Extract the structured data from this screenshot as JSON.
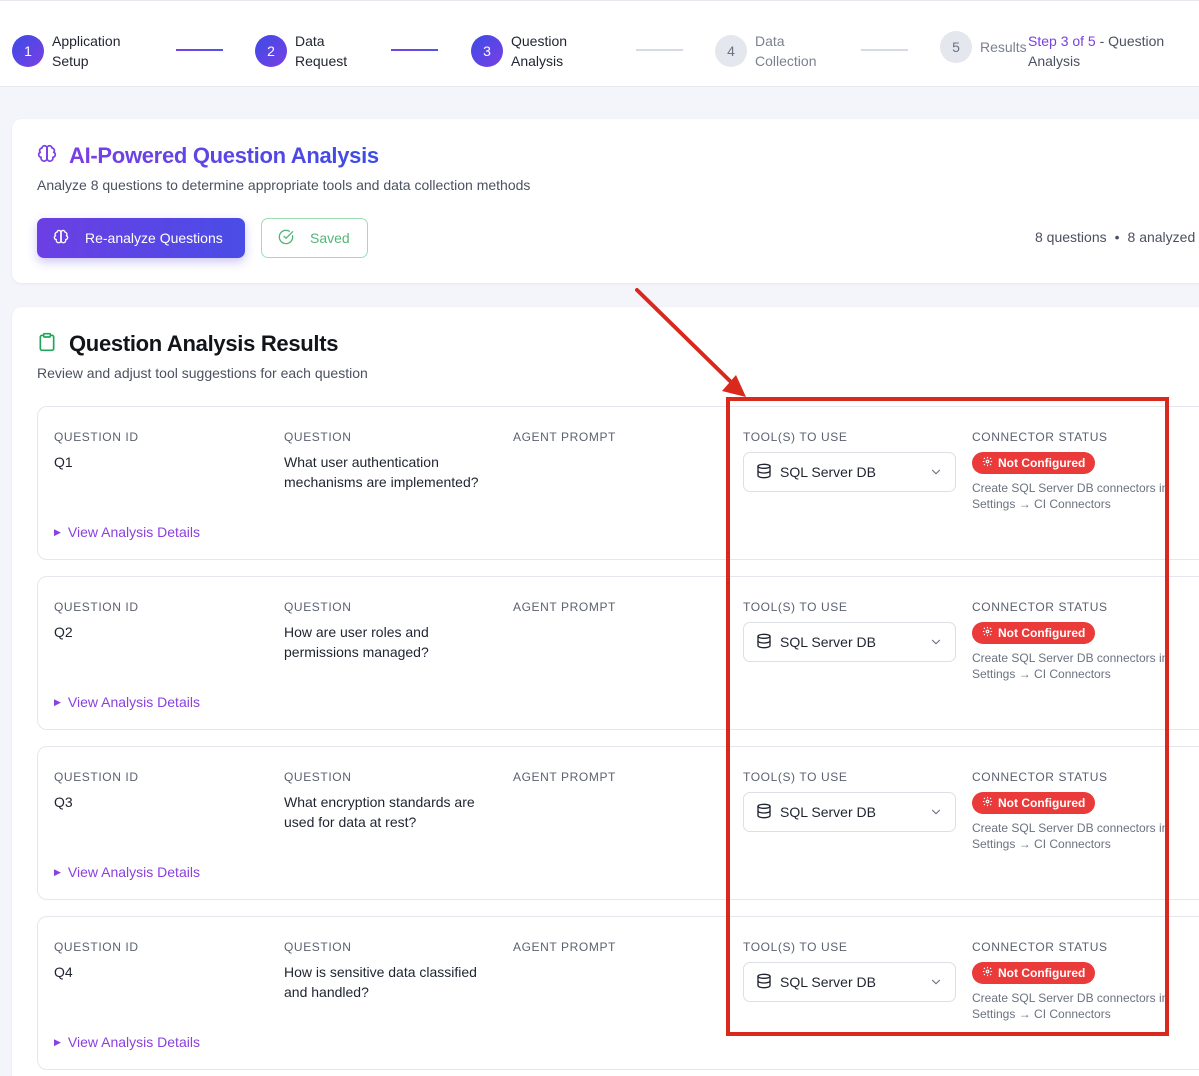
{
  "stepper": {
    "steps": [
      {
        "num": "1",
        "label_line1": "Application",
        "label_line2": "Setup",
        "state": "done"
      },
      {
        "num": "2",
        "label_line1": "Data",
        "label_line2": "Request",
        "state": "done"
      },
      {
        "num": "3",
        "label_line1": "Question",
        "label_line2": "Analysis",
        "state": "current"
      },
      {
        "num": "4",
        "label_line1": "Data",
        "label_line2": "Collection",
        "state": "todo"
      },
      {
        "num": "5",
        "label_line1": "Results",
        "label_line2": "",
        "state": "todo"
      }
    ],
    "info_highlight": "Step 3 of 5",
    "info_rest": " - Question Analysis"
  },
  "analysis": {
    "title": "AI-Powered Question Analysis",
    "subtitle": "Analyze 8 questions to determine appropriate tools and data collection methods",
    "reanalyze_label": "Re-analyze Questions",
    "saved_label": "Saved",
    "stats_questions": "8 questions",
    "stats_dot": "•",
    "stats_analyzed": "8 analyzed"
  },
  "results": {
    "title": "Question Analysis Results",
    "subtitle": "Review and adjust tool suggestions for each question",
    "headers": {
      "question_id": "QUESTION ID",
      "question": "QUESTION",
      "agent_prompt": "AGENT PROMPT",
      "tools": "TOOL(S) TO USE",
      "connector_status": "CONNECTOR STATUS"
    },
    "view_details_label": "View Analysis Details",
    "rows": [
      {
        "id": "Q1",
        "question": "What user authentication mechanisms are implemented?",
        "agent_prompt": "",
        "tool": "SQL Server DB",
        "status": "Not Configured",
        "note": "Create SQL Server DB connectors in Settings → CI Connectors"
      },
      {
        "id": "Q2",
        "question": "How are user roles and permissions managed?",
        "agent_prompt": "",
        "tool": "SQL Server DB",
        "status": "Not Configured",
        "note": "Create SQL Server DB connectors in Settings → CI Connectors"
      },
      {
        "id": "Q3",
        "question": "What encryption standards are used for data at rest?",
        "agent_prompt": "",
        "tool": "SQL Server DB",
        "status": "Not Configured",
        "note": "Create SQL Server DB connectors in Settings → CI Connectors"
      },
      {
        "id": "Q4",
        "question": "How is sensitive data classified and handled?",
        "agent_prompt": "",
        "tool": "SQL Server DB",
        "status": "Not Configured",
        "note": "Create SQL Server DB connectors in Settings → CI Connectors"
      }
    ]
  },
  "colors": {
    "accent_purple": "#7b3fe4",
    "accent_blue": "#3b4ce6",
    "status_red": "#ea3a3a",
    "saved_green": "#54b57a",
    "annotation_red": "#d9281c"
  },
  "icons": {
    "brain": "brain-icon",
    "clipboard": "clipboard-icon",
    "check_circle": "check-circle-icon",
    "database": "database-icon",
    "chevron": "chevron-down-icon",
    "gear": "gear-icon"
  }
}
